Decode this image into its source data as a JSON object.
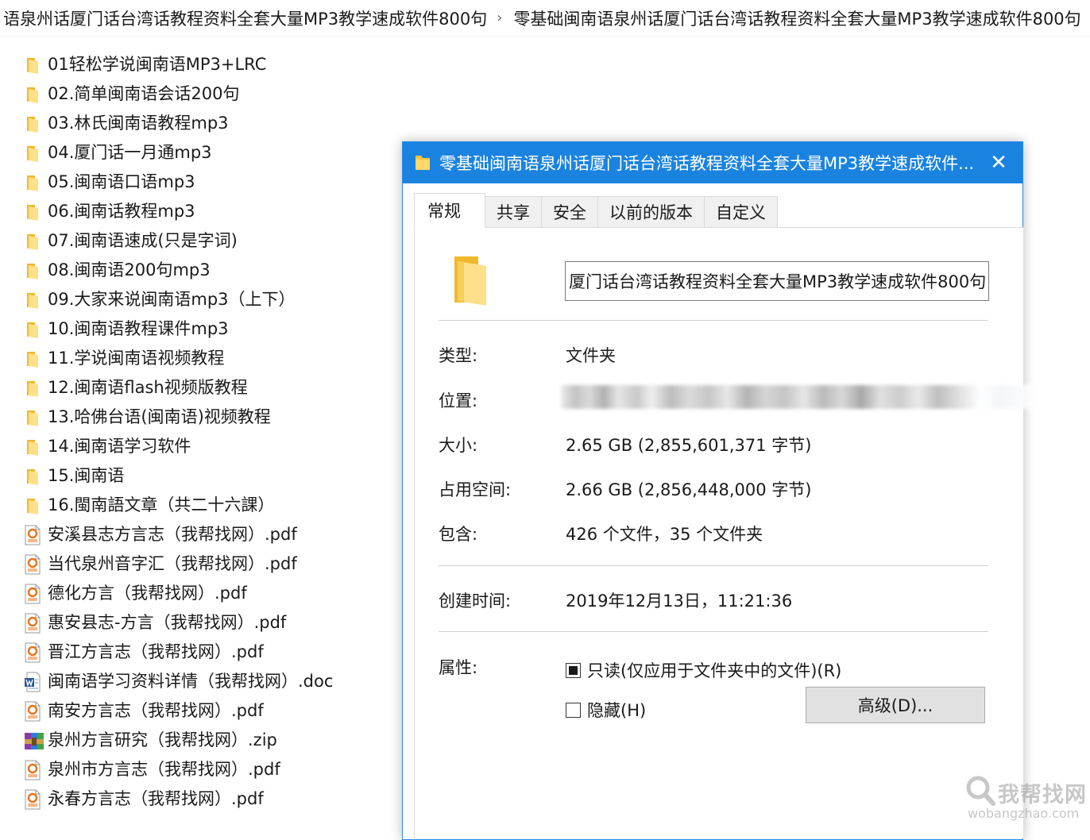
{
  "breadcrumb": {
    "items": [
      "语泉州话厦门话台湾话教程资料全套大量MP3教学速成软件800句",
      "零基础闽南语泉州话厦门话台湾话教程资料全套大量MP3教学速成软件800句"
    ],
    "separator": "›"
  },
  "files": [
    {
      "name": "01轻松学说闽南语MP3+LRC",
      "type": "folder"
    },
    {
      "name": "02.简单闽南语会话200句",
      "type": "folder"
    },
    {
      "name": "03.林氏闽南语教程mp3",
      "type": "folder"
    },
    {
      "name": "04.厦门话一月通mp3",
      "type": "folder"
    },
    {
      "name": "05.闽南语口语mp3",
      "type": "folder"
    },
    {
      "name": "06.闽南话教程mp3",
      "type": "folder"
    },
    {
      "name": "07.闽南语速成(只是字词)",
      "type": "folder"
    },
    {
      "name": "08.闽南语200句mp3",
      "type": "folder"
    },
    {
      "name": "09.大家来说闽南语mp3（上下）",
      "type": "folder"
    },
    {
      "name": "10.闽南语教程课件mp3",
      "type": "folder"
    },
    {
      "name": "11.学说闽南语视频教程",
      "type": "folder"
    },
    {
      "name": "12.闽南语flash视频版教程",
      "type": "folder"
    },
    {
      "name": "13.哈佛台语(闽南语)视频教程",
      "type": "folder"
    },
    {
      "name": "14.闽南语学习软件",
      "type": "folder"
    },
    {
      "name": "15.闽南语",
      "type": "folder"
    },
    {
      "name": "16.閩南語文章（共二十六課）",
      "type": "folder"
    },
    {
      "name": "安溪县志方言志（我帮找网）.pdf",
      "type": "pdf"
    },
    {
      "name": "当代泉州音字汇（我帮找网）.pdf",
      "type": "pdf"
    },
    {
      "name": "德化方言（我帮找网）.pdf",
      "type": "pdf"
    },
    {
      "name": "惠安县志-方言（我帮找网）.pdf",
      "type": "pdf"
    },
    {
      "name": "晋江方言志（我帮找网）.pdf",
      "type": "pdf"
    },
    {
      "name": "闽南语学习资料详情（我帮找网）.doc",
      "type": "doc"
    },
    {
      "name": "南安方言志（我帮找网）.pdf",
      "type": "pdf"
    },
    {
      "name": "泉州方言研究（我帮找网）.zip",
      "type": "zip"
    },
    {
      "name": "泉州市方言志（我帮找网）.pdf",
      "type": "pdf"
    },
    {
      "name": "永春方言志（我帮找网）.pdf",
      "type": "pdf"
    }
  ],
  "dialog": {
    "title": "零基础闽南语泉州话厦门话台湾话教程资料全套大量MP3教学速成软件...",
    "close": "✕",
    "tabs": [
      "常规",
      "共享",
      "安全",
      "以前的版本",
      "自定义"
    ],
    "active_tab": "常规",
    "name_value": "厦门话台湾话教程资料全套大量MP3教学速成软件800句",
    "properties": {
      "type_label": "类型:",
      "type_value": "文件夹",
      "location_label": "位置:",
      "size_label": "大小:",
      "size_value": "2.65 GB (2,855,601,371 字节)",
      "disk_label": "占用空间:",
      "disk_value": "2.66 GB (2,856,448,000 字节)",
      "contains_label": "包含:",
      "contains_value": "426 个文件，35 个文件夹",
      "created_label": "创建时间:",
      "created_value": "2019年12月13日，11:21:36",
      "attributes_label": "属性:"
    },
    "attributes": {
      "readonly_label": "只读(仅应用于文件夹中的文件)(R)",
      "readonly_state": "indeterminate",
      "hidden_label": "隐藏(H)",
      "hidden_state": "unchecked",
      "advanced_button": "高级(D)..."
    }
  },
  "watermark": {
    "cn": "我帮找网",
    "en": "wobangzhao.com"
  },
  "colors": {
    "titlebar": "#1a83e0",
    "folder_yellow": "#f5c542",
    "folder_light": "#ffe08a",
    "pdf_orange": "#e8741c"
  }
}
